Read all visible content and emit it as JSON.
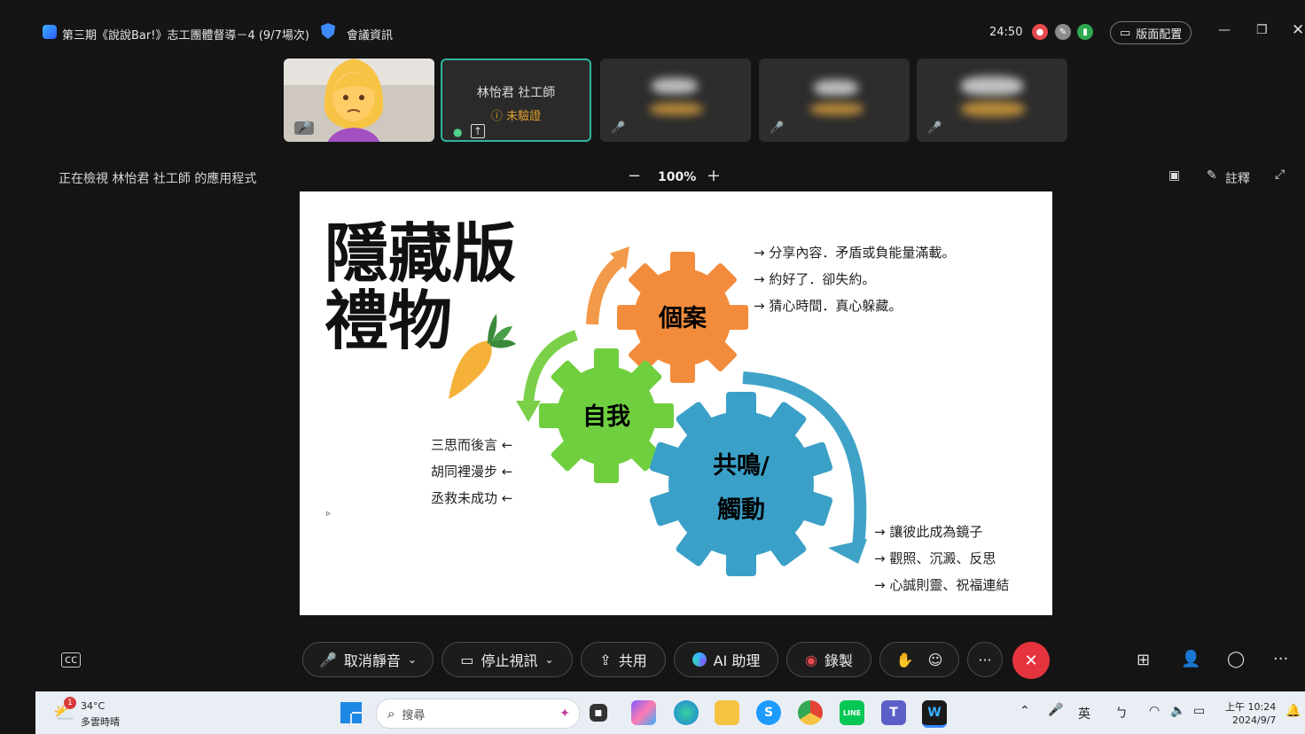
{
  "titlebar": {
    "meeting_title": "第三期《說說Bar!》志工團體督導－4 (9/7場次)",
    "meeting_info": "會議資訊",
    "timer": "24:50",
    "layout_label": "版面配置"
  },
  "participants": [
    {
      "name": "",
      "type": "self-emoji"
    },
    {
      "name": "林怡君 社工師",
      "status": "未驗證",
      "active": true
    },
    {
      "name": "",
      "type": "blurred"
    },
    {
      "name": "",
      "type": "blurred"
    },
    {
      "name": "",
      "type": "blurred"
    }
  ],
  "share_bar": {
    "viewing_text": "正在檢視 林怡君 社工師 的應用程式",
    "zoom_minus": "−",
    "zoom_level": "100%",
    "zoom_plus": "+",
    "annotate_label": "註釋"
  },
  "slide": {
    "title_line1": "隱藏版",
    "title_line2": "禮物",
    "gear_case": "個案",
    "gear_self": "自我",
    "gear_resonance_line1": "共鳴/",
    "gear_resonance_line2": "觸動",
    "case_points": [
      "→ 分享內容．矛盾或負能量滿載。",
      "→ 約好了．卻失約。",
      "→ 猜心時間．真心躲藏。"
    ],
    "self_points": [
      "三思而後言 ←",
      "胡同裡漫步 ←",
      "丞救未成功 ←"
    ],
    "resonance_points": [
      "→ 讓彼此成為鏡子",
      "→ 觀照、沉澱、反思",
      "→ 心誠則靈、祝福連結"
    ],
    "colors": {
      "orange": "#f28c3c",
      "green": "#6fcf3f",
      "blue": "#3aa0c8",
      "arrow_orange": "#f29a4a",
      "arrow_green": "#7bd04a",
      "arrow_blue": "#3fa3c8"
    }
  },
  "controls": {
    "unmute": "取消靜音",
    "stop_video": "停止視訊",
    "share": "共用",
    "ai_assistant": "AI 助理",
    "record": "錄製",
    "more": "···"
  },
  "taskbar": {
    "weather_temp": "34°C",
    "weather_desc": "多雲時晴",
    "weather_badge": "1",
    "search_placeholder": "搜尋",
    "ime": "英",
    "time": "上午 10:24",
    "date": "2024/9/7"
  }
}
